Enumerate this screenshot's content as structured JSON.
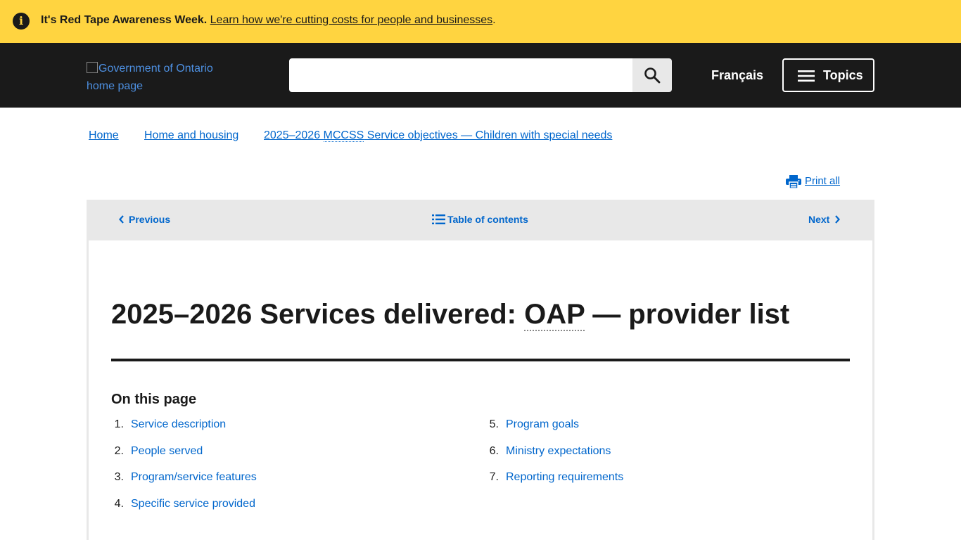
{
  "alert": {
    "icon": "info-icon",
    "bold_text": "It's Red Tape Awareness Week.",
    "link_text": "Learn how we're cutting costs for people and businesses",
    "trailing": "."
  },
  "header": {
    "logo_alt_line1": "Government of Ontario",
    "logo_alt_line2": "home page",
    "search_placeholder": "",
    "search_icon": "search-icon",
    "language_link": "Français",
    "topics_label": "Topics",
    "topics_icon": "hamburger-icon"
  },
  "breadcrumb": {
    "items": [
      {
        "label": "Home"
      },
      {
        "label": "Home and housing"
      },
      {
        "label_before": "2025–2026 ",
        "abbr": "MCCSS",
        "label_after": " Service objectives — Children with special needs"
      }
    ]
  },
  "print_all": {
    "label": " Print all",
    "icon": "printer-icon"
  },
  "pagination": {
    "previous": "Previous",
    "toc": "Table of contents",
    "next": "Next"
  },
  "page": {
    "title_before": "2025–2026 Services delivered: ",
    "title_abbr": "OAP",
    "title_after": " — provider list",
    "on_this_page": "On this page",
    "toc": [
      {
        "num": "1.",
        "label": "Service description"
      },
      {
        "num": "2.",
        "label": "People served"
      },
      {
        "num": "3.",
        "label": "Program/service features"
      },
      {
        "num": "4.",
        "label": "Specific service provided"
      },
      {
        "num": "5.",
        "label": "Program goals"
      },
      {
        "num": "6.",
        "label": "Ministry expectations"
      },
      {
        "num": "7.",
        "label": "Reporting requirements"
      }
    ]
  },
  "colors": {
    "alert_bg": "#ffd440",
    "header_bg": "#1a1a1a",
    "link": "#0066cc",
    "nav_bg": "#e8e8e8"
  }
}
